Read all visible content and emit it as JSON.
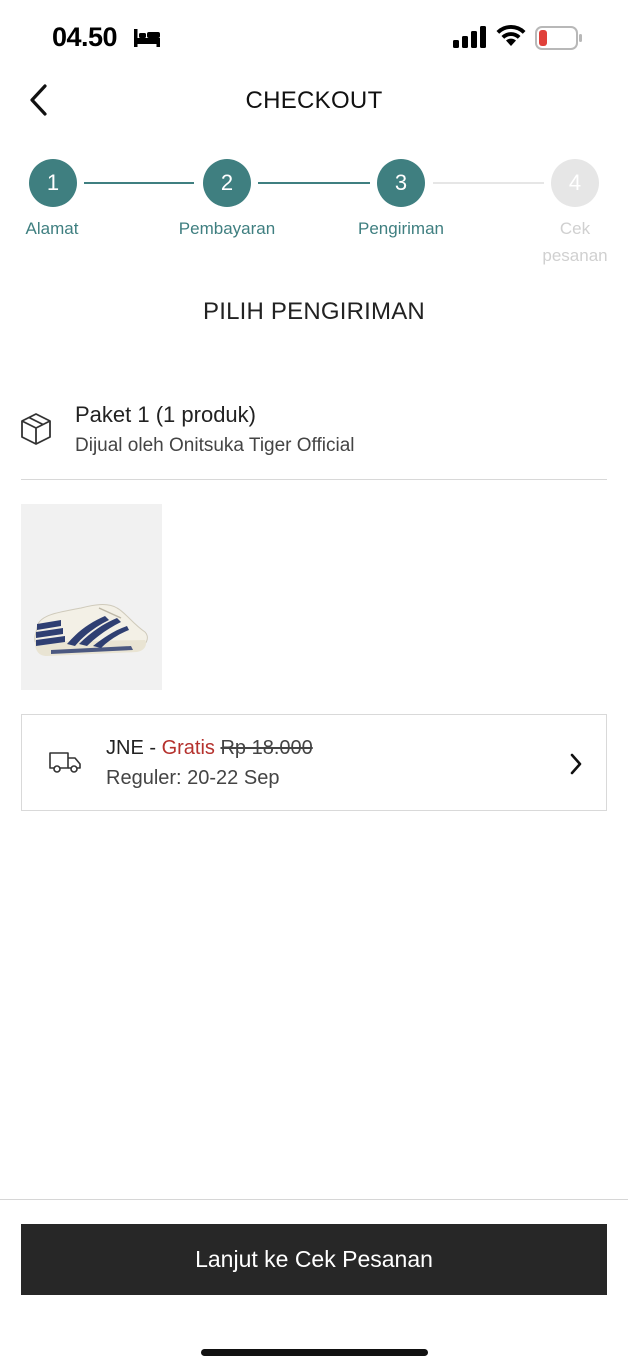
{
  "status_bar": {
    "time": "04.50",
    "icons": [
      "bed-icon",
      "signal-icon",
      "wifi-icon",
      "battery-icon"
    ],
    "battery_color": "#e0403a"
  },
  "header": {
    "title": "CHECKOUT",
    "back_icon": "chevron-left-icon"
  },
  "stepper": {
    "active_color": "#3f7f80",
    "inactive_color": "#e6e6e6",
    "steps": [
      {
        "number": "1",
        "label": "Alamat",
        "active": true
      },
      {
        "number": "2",
        "label": "Pembayaran",
        "active": true
      },
      {
        "number": "3",
        "label": "Pengiriman",
        "active": true
      },
      {
        "number": "4",
        "label": "Cek pesanan",
        "active": false
      }
    ]
  },
  "section_title": "PILIH PENGIRIMAN",
  "package": {
    "icon": "package-icon",
    "title": "Paket 1 (1 produk)",
    "seller": "Dijual oleh Onitsuka Tiger Official"
  },
  "shipping": {
    "icon": "truck-icon",
    "courier": "JNE - ",
    "free_label": "Gratis",
    "original_price": "Rp 18.000",
    "service": "Reguler: 20-22 Sep",
    "free_color": "#b5312d"
  },
  "footer": {
    "continue_label": "Lanjut ke Cek Pesanan"
  }
}
